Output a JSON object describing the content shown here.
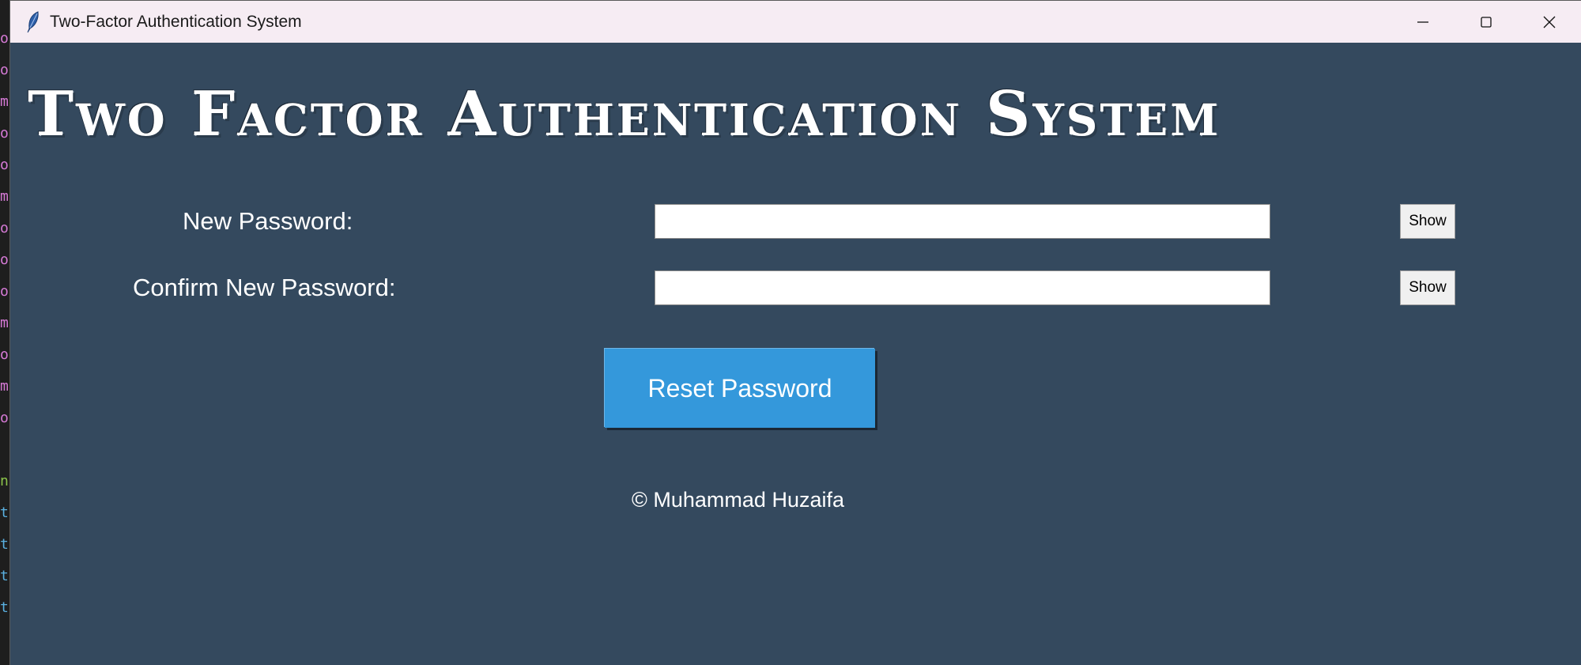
{
  "window": {
    "title": "Two-Factor Authentication System",
    "icon": "feather-icon",
    "controls": [
      "minimize-icon",
      "maximize-icon",
      "close-icon"
    ]
  },
  "main": {
    "heading": "Two Factor Authentication System",
    "new_password_label": "New Password:",
    "new_password_value": "",
    "new_password_show": "Show",
    "confirm_password_label": "Confirm New Password:",
    "confirm_password_value": "",
    "confirm_password_show": "Show",
    "reset_button": "Reset Password",
    "footer": "© Muhammad Huzaifa"
  },
  "colors": {
    "background": "#34495e",
    "accent": "#3498db",
    "titlebar": "#f6ecf3"
  }
}
